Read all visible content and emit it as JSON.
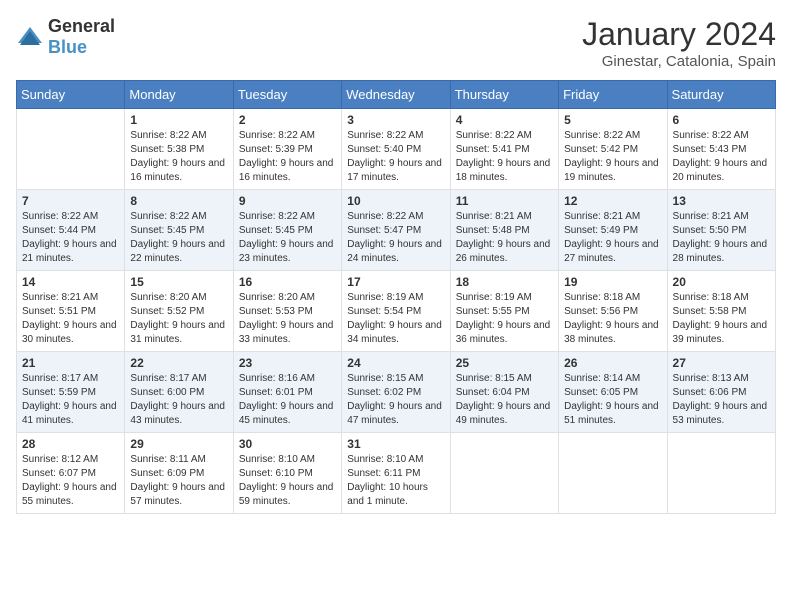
{
  "header": {
    "logo_general": "General",
    "logo_blue": "Blue",
    "month_title": "January 2024",
    "location": "Ginestar, Catalonia, Spain"
  },
  "columns": [
    "Sunday",
    "Monday",
    "Tuesday",
    "Wednesday",
    "Thursday",
    "Friday",
    "Saturday"
  ],
  "weeks": [
    [
      {
        "day": "",
        "sunrise": "",
        "sunset": "",
        "daylight": ""
      },
      {
        "day": "1",
        "sunrise": "Sunrise: 8:22 AM",
        "sunset": "Sunset: 5:38 PM",
        "daylight": "Daylight: 9 hours and 16 minutes."
      },
      {
        "day": "2",
        "sunrise": "Sunrise: 8:22 AM",
        "sunset": "Sunset: 5:39 PM",
        "daylight": "Daylight: 9 hours and 16 minutes."
      },
      {
        "day": "3",
        "sunrise": "Sunrise: 8:22 AM",
        "sunset": "Sunset: 5:40 PM",
        "daylight": "Daylight: 9 hours and 17 minutes."
      },
      {
        "day": "4",
        "sunrise": "Sunrise: 8:22 AM",
        "sunset": "Sunset: 5:41 PM",
        "daylight": "Daylight: 9 hours and 18 minutes."
      },
      {
        "day": "5",
        "sunrise": "Sunrise: 8:22 AM",
        "sunset": "Sunset: 5:42 PM",
        "daylight": "Daylight: 9 hours and 19 minutes."
      },
      {
        "day": "6",
        "sunrise": "Sunrise: 8:22 AM",
        "sunset": "Sunset: 5:43 PM",
        "daylight": "Daylight: 9 hours and 20 minutes."
      }
    ],
    [
      {
        "day": "7",
        "sunrise": "Sunrise: 8:22 AM",
        "sunset": "Sunset: 5:44 PM",
        "daylight": "Daylight: 9 hours and 21 minutes."
      },
      {
        "day": "8",
        "sunrise": "Sunrise: 8:22 AM",
        "sunset": "Sunset: 5:45 PM",
        "daylight": "Daylight: 9 hours and 22 minutes."
      },
      {
        "day": "9",
        "sunrise": "Sunrise: 8:22 AM",
        "sunset": "Sunset: 5:45 PM",
        "daylight": "Daylight: 9 hours and 23 minutes."
      },
      {
        "day": "10",
        "sunrise": "Sunrise: 8:22 AM",
        "sunset": "Sunset: 5:47 PM",
        "daylight": "Daylight: 9 hours and 24 minutes."
      },
      {
        "day": "11",
        "sunrise": "Sunrise: 8:21 AM",
        "sunset": "Sunset: 5:48 PM",
        "daylight": "Daylight: 9 hours and 26 minutes."
      },
      {
        "day": "12",
        "sunrise": "Sunrise: 8:21 AM",
        "sunset": "Sunset: 5:49 PM",
        "daylight": "Daylight: 9 hours and 27 minutes."
      },
      {
        "day": "13",
        "sunrise": "Sunrise: 8:21 AM",
        "sunset": "Sunset: 5:50 PM",
        "daylight": "Daylight: 9 hours and 28 minutes."
      }
    ],
    [
      {
        "day": "14",
        "sunrise": "Sunrise: 8:21 AM",
        "sunset": "Sunset: 5:51 PM",
        "daylight": "Daylight: 9 hours and 30 minutes."
      },
      {
        "day": "15",
        "sunrise": "Sunrise: 8:20 AM",
        "sunset": "Sunset: 5:52 PM",
        "daylight": "Daylight: 9 hours and 31 minutes."
      },
      {
        "day": "16",
        "sunrise": "Sunrise: 8:20 AM",
        "sunset": "Sunset: 5:53 PM",
        "daylight": "Daylight: 9 hours and 33 minutes."
      },
      {
        "day": "17",
        "sunrise": "Sunrise: 8:19 AM",
        "sunset": "Sunset: 5:54 PM",
        "daylight": "Daylight: 9 hours and 34 minutes."
      },
      {
        "day": "18",
        "sunrise": "Sunrise: 8:19 AM",
        "sunset": "Sunset: 5:55 PM",
        "daylight": "Daylight: 9 hours and 36 minutes."
      },
      {
        "day": "19",
        "sunrise": "Sunrise: 8:18 AM",
        "sunset": "Sunset: 5:56 PM",
        "daylight": "Daylight: 9 hours and 38 minutes."
      },
      {
        "day": "20",
        "sunrise": "Sunrise: 8:18 AM",
        "sunset": "Sunset: 5:58 PM",
        "daylight": "Daylight: 9 hours and 39 minutes."
      }
    ],
    [
      {
        "day": "21",
        "sunrise": "Sunrise: 8:17 AM",
        "sunset": "Sunset: 5:59 PM",
        "daylight": "Daylight: 9 hours and 41 minutes."
      },
      {
        "day": "22",
        "sunrise": "Sunrise: 8:17 AM",
        "sunset": "Sunset: 6:00 PM",
        "daylight": "Daylight: 9 hours and 43 minutes."
      },
      {
        "day": "23",
        "sunrise": "Sunrise: 8:16 AM",
        "sunset": "Sunset: 6:01 PM",
        "daylight": "Daylight: 9 hours and 45 minutes."
      },
      {
        "day": "24",
        "sunrise": "Sunrise: 8:15 AM",
        "sunset": "Sunset: 6:02 PM",
        "daylight": "Daylight: 9 hours and 47 minutes."
      },
      {
        "day": "25",
        "sunrise": "Sunrise: 8:15 AM",
        "sunset": "Sunset: 6:04 PM",
        "daylight": "Daylight: 9 hours and 49 minutes."
      },
      {
        "day": "26",
        "sunrise": "Sunrise: 8:14 AM",
        "sunset": "Sunset: 6:05 PM",
        "daylight": "Daylight: 9 hours and 51 minutes."
      },
      {
        "day": "27",
        "sunrise": "Sunrise: 8:13 AM",
        "sunset": "Sunset: 6:06 PM",
        "daylight": "Daylight: 9 hours and 53 minutes."
      }
    ],
    [
      {
        "day": "28",
        "sunrise": "Sunrise: 8:12 AM",
        "sunset": "Sunset: 6:07 PM",
        "daylight": "Daylight: 9 hours and 55 minutes."
      },
      {
        "day": "29",
        "sunrise": "Sunrise: 8:11 AM",
        "sunset": "Sunset: 6:09 PM",
        "daylight": "Daylight: 9 hours and 57 minutes."
      },
      {
        "day": "30",
        "sunrise": "Sunrise: 8:10 AM",
        "sunset": "Sunset: 6:10 PM",
        "daylight": "Daylight: 9 hours and 59 minutes."
      },
      {
        "day": "31",
        "sunrise": "Sunrise: 8:10 AM",
        "sunset": "Sunset: 6:11 PM",
        "daylight": "Daylight: 10 hours and 1 minute."
      },
      {
        "day": "",
        "sunrise": "",
        "sunset": "",
        "daylight": ""
      },
      {
        "day": "",
        "sunrise": "",
        "sunset": "",
        "daylight": ""
      },
      {
        "day": "",
        "sunrise": "",
        "sunset": "",
        "daylight": ""
      }
    ]
  ]
}
